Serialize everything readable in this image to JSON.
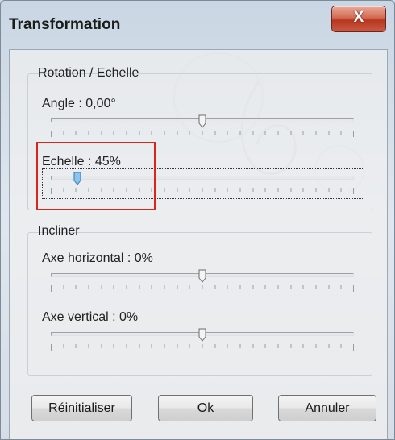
{
  "window": {
    "title": "Transformation",
    "close_label": "X"
  },
  "rotation_group": {
    "label": "Rotation / Echelle",
    "angle": {
      "label": "Angle : 0,00°",
      "position": 0.5
    },
    "scale": {
      "label": "Echelle : 45%",
      "position": 0.08
    }
  },
  "incliner_group": {
    "label": "Incliner",
    "horizontal": {
      "label": "Axe horizontal : 0%",
      "position": 0.5
    },
    "vertical": {
      "label": "Axe vertical : 0%",
      "position": 0.5
    }
  },
  "buttons": {
    "reset": "Réinitialiser",
    "ok": "Ok",
    "cancel": "Annuler"
  },
  "colors": {
    "highlight": "#d9251c",
    "thumb": "#5aa0d8",
    "close": "#c24a33"
  },
  "icons": {
    "close": "close-icon",
    "thumb": "slider-thumb-icon"
  }
}
